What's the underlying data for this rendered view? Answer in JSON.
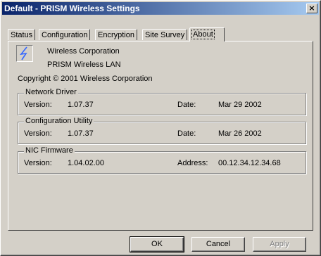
{
  "window": {
    "title": "Default - PRISM Wireless Settings",
    "close_label": "×"
  },
  "tabs": [
    {
      "label": "Status"
    },
    {
      "label": "Configuration"
    },
    {
      "label": "Encryption"
    },
    {
      "label": "Site Survey"
    },
    {
      "label": "About",
      "active": true
    }
  ],
  "about": {
    "company": "Wireless Corporation",
    "product": "PRISM Wireless LAN",
    "copyright": "Copyright © 2001 Wireless Corporation",
    "icon": "lightning-bolt-icon"
  },
  "groups": {
    "network_driver": {
      "title": "Network Driver",
      "version_label": "Version:",
      "version": "1.07.37",
      "date_label": "Date:",
      "date": "Mar 29 2002"
    },
    "config_utility": {
      "title": "Configuration Utility",
      "version_label": "Version:",
      "version": "1.07.37",
      "date_label": "Date:",
      "date": "Mar 26 2002"
    },
    "nic_firmware": {
      "title": "NIC Firmware",
      "version_label": "Version:",
      "version": "1.04.02.00",
      "address_label": "Address:",
      "address": "00.12.34.12.34.68"
    }
  },
  "buttons": {
    "ok": "OK",
    "cancel": "Cancel",
    "apply": "Apply"
  },
  "colors": {
    "titlebar_start": "#0a246a",
    "titlebar_end": "#a6caf0",
    "face": "#d4d0c8",
    "icon_bolt": "#3366ff"
  }
}
